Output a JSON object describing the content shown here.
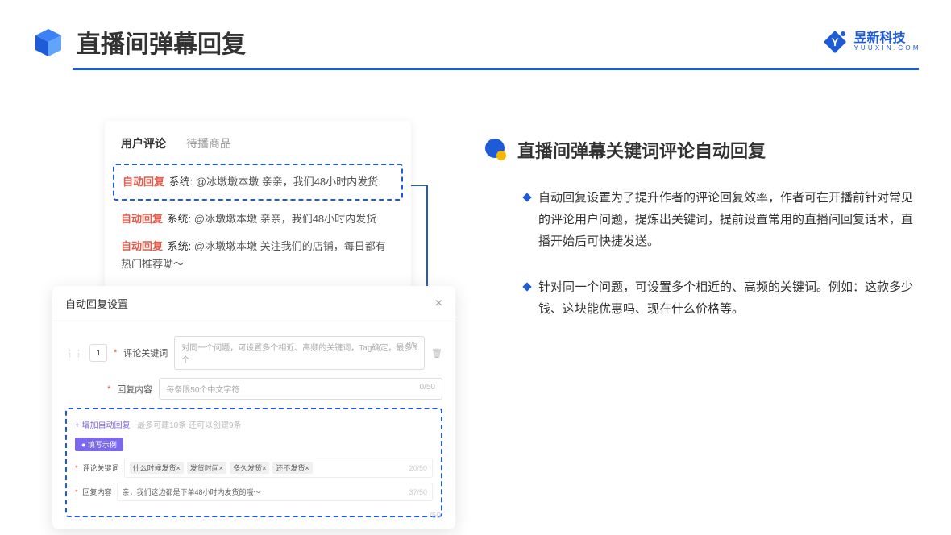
{
  "header": {
    "title": "直播间弹幕回复",
    "logo_cn": "昱新科技",
    "logo_en": "Y U U X I N . C O M"
  },
  "comments": {
    "tab_user": "用户评论",
    "tab_goods": "待播商品",
    "row1_badge": "自动回复",
    "row1_sys": "系统:",
    "row1_text": "@冰墩墩本墩 亲亲，我们48小时内发货",
    "row2_badge": "自动回复",
    "row2_sys": "系统:",
    "row2_text": "@冰墩墩本墩 亲亲，我们48小时内发货",
    "row3_badge": "自动回复",
    "row3_sys": "系统:",
    "row3_text": "@冰墩墩本墩 关注我们的店铺，每日都有热门推荐呦～"
  },
  "settings": {
    "title": "自动回复设置",
    "number": "1",
    "kw_label": "评论关键词",
    "kw_placeholder": "对同一个问题，可设置多个相近、高频的关键词，Tag确定，最多5个",
    "kw_count": "0/5",
    "content_label": "回复内容",
    "content_placeholder": "每条限50个中文字符",
    "content_count": "0/50",
    "add_text": "+ 增加自动回复",
    "add_hint": "最多可建10条 还可以创建9条",
    "example_badge": "● 填写示例",
    "ex_kw_label": "评论关键词",
    "ex_tags": [
      "什么时候发货×",
      "发货时间×",
      "多久发货×",
      "还不发货×"
    ],
    "ex_kw_count": "20/50",
    "ex_content_label": "回复内容",
    "ex_content_text": "亲，我们这边都是下单48小时内发货的哦～",
    "ex_content_count": "37/50",
    "bottom_count": "/50"
  },
  "right": {
    "section_title": "直播间弹幕关键词评论自动回复",
    "bullet1": "自动回复设置为了提升作者的评论回复效率，作者可在开播前针对常见的评论用户问题，提炼出关键词，提前设置常用的直播间回复话术，直播开始后可快捷发送。",
    "bullet2": "针对同一个问题，可设置多个相近的、高频的关键词。例如：这款多少钱、这块能优惠吗、现在什么价格等。"
  }
}
